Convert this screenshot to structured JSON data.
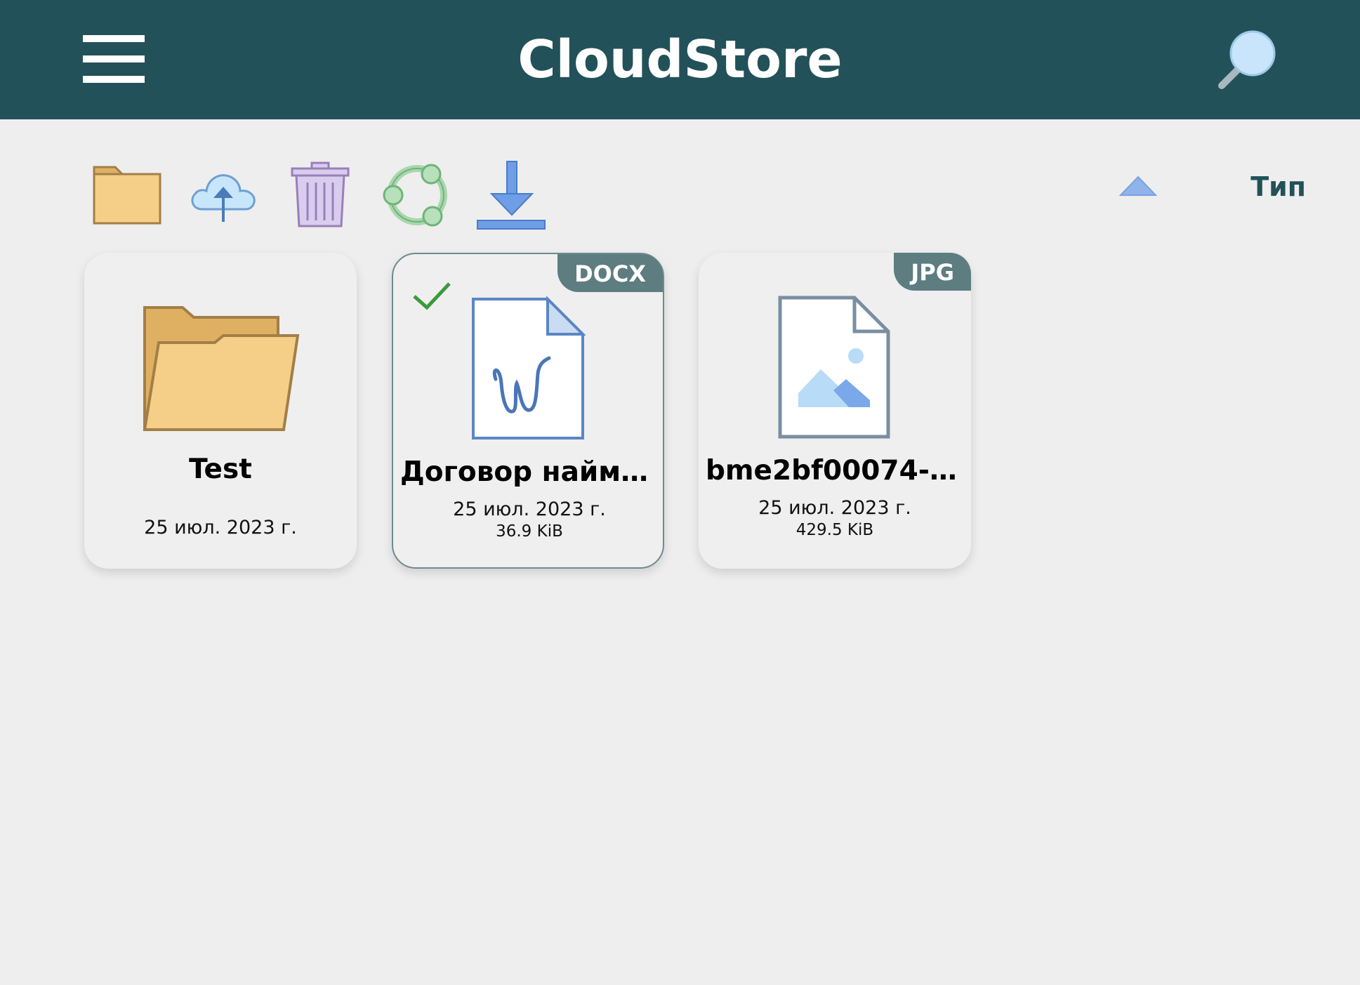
{
  "header": {
    "title": "CloudStore",
    "background": "#225159",
    "menu_icon": "hamburger-menu-icon",
    "search_icon": "magnifier-icon"
  },
  "toolbar": {
    "actions": [
      {
        "name": "new-folder",
        "icon": "folder-icon"
      },
      {
        "name": "upload",
        "icon": "cloud-upload-icon"
      },
      {
        "name": "delete",
        "icon": "trash-icon"
      },
      {
        "name": "share",
        "icon": "share-icon"
      },
      {
        "name": "download",
        "icon": "download-icon"
      }
    ],
    "sort": {
      "label": "Тип",
      "direction": "ascending",
      "icon": "triangle-up-icon"
    }
  },
  "files": [
    {
      "kind": "folder",
      "name": "Test",
      "date": "25 июл. 2023 г.",
      "icon": "folder-open-icon",
      "selected": false
    },
    {
      "kind": "file",
      "type_badge": "DOCX",
      "name": "Договор найма...",
      "date": "25 июл. 2023 г.",
      "size": "36.9 KiB",
      "icon": "word-document-icon",
      "selected": true
    },
    {
      "kind": "file",
      "type_badge": "JPG",
      "name": "bme2bf00074-fi...",
      "date": "25 июл. 2023 г.",
      "size": "429.5 KiB",
      "icon": "image-file-icon",
      "selected": false
    }
  ],
  "colors": {
    "header": "#225159",
    "background": "#eeeeee",
    "badge": "#5d7d80",
    "selected_check": "#3a9a3a",
    "sort_arrow": "#8fb3ea"
  }
}
